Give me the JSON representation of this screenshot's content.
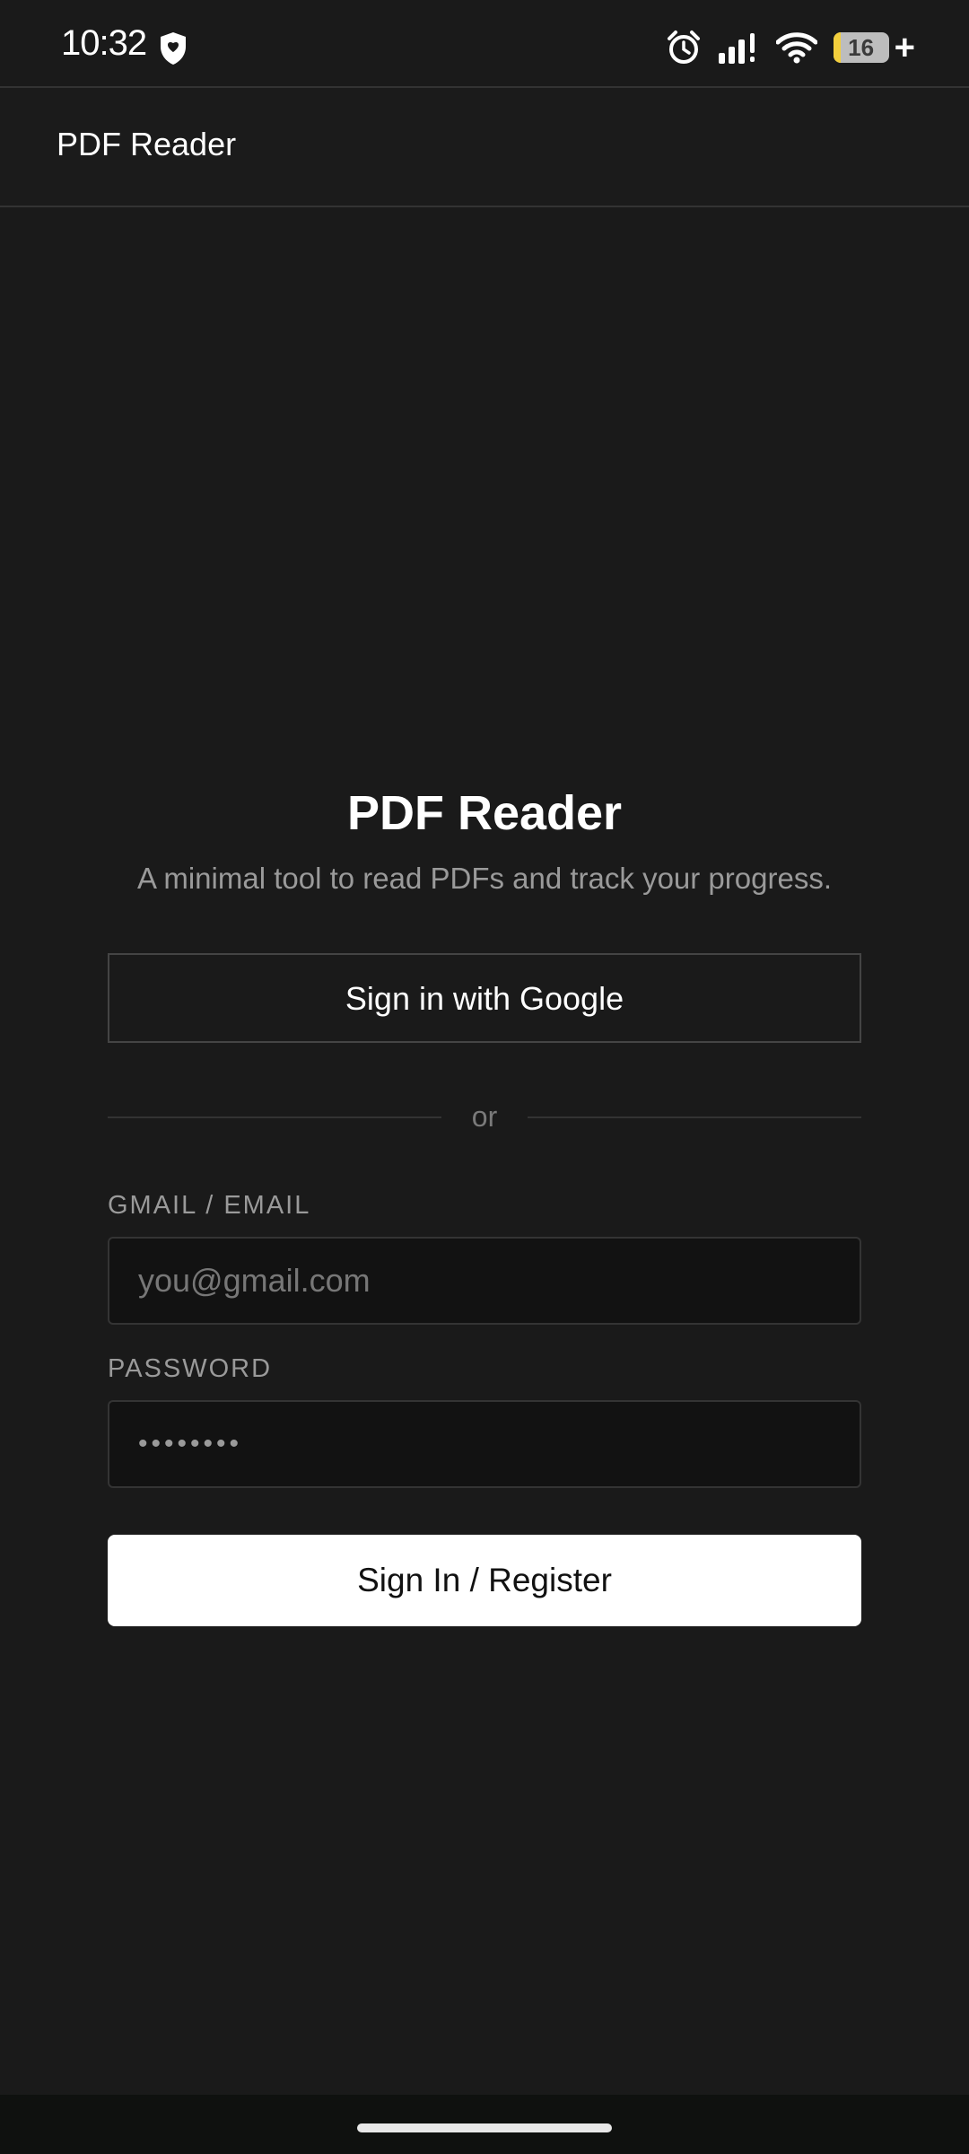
{
  "status_bar": {
    "time": "10:32",
    "battery_level": "16",
    "battery_plus": "+",
    "icons": [
      "shield-icon",
      "alarm-icon",
      "signal-icon",
      "wifi-icon",
      "battery-icon"
    ]
  },
  "app_bar": {
    "title": "PDF Reader"
  },
  "main": {
    "title": "PDF Reader",
    "subtitle": "A minimal tool to read PDFs and track your progress.",
    "google_button_label": "Sign in with Google",
    "divider_text": "or",
    "email_label": "GMAIL / EMAIL",
    "email_placeholder": "you@gmail.com",
    "email_value": "",
    "password_label": "PASSWORD",
    "password_value": "••••••••",
    "submit_label": "Sign In / Register"
  },
  "colors": {
    "background": "#1a1a1a",
    "input_background": "#121212",
    "primary_button": "#ffffff",
    "battery_fill": "#f3cf3c"
  }
}
